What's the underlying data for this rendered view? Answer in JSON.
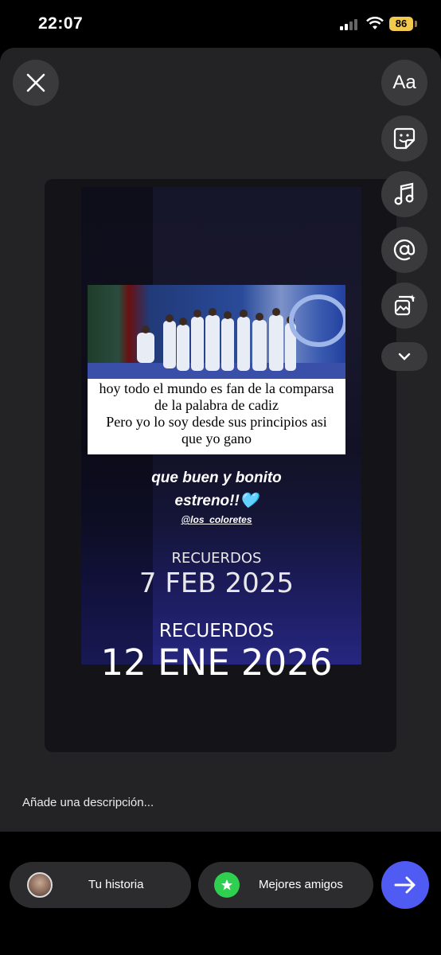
{
  "status_bar": {
    "time": "22:07",
    "battery": "86"
  },
  "story": {
    "meme_text_lines": [
      "hoy todo el mundo es fan de la comparsa",
      "de la palabra de cadiz",
      "Pero yo lo soy desde sus principios asi",
      "que yo gano"
    ],
    "caption_line1": "que buen y bonito",
    "caption_line2": "estreno!!🩵",
    "mention": "@los_coloretes",
    "memory1_label": "RECUERDOS",
    "memory1_date": "7 FEB 2025",
    "memory2_label": "RECUERDOS",
    "memory2_date": "12 ENE 2026"
  },
  "tools": {
    "text_label": "Aa",
    "items": [
      "text-tool",
      "sticker-tool",
      "music-tool",
      "mention-tool",
      "effects-tool",
      "more-tools"
    ]
  },
  "description_placeholder": "Añade una descripción...",
  "share": {
    "your_story": "Tu historia",
    "close_friends": "Mejores amigos"
  },
  "colors": {
    "send_button": "#4f5bf2",
    "close_friends_badge": "#2fd04f",
    "battery": "#f2c94c"
  }
}
